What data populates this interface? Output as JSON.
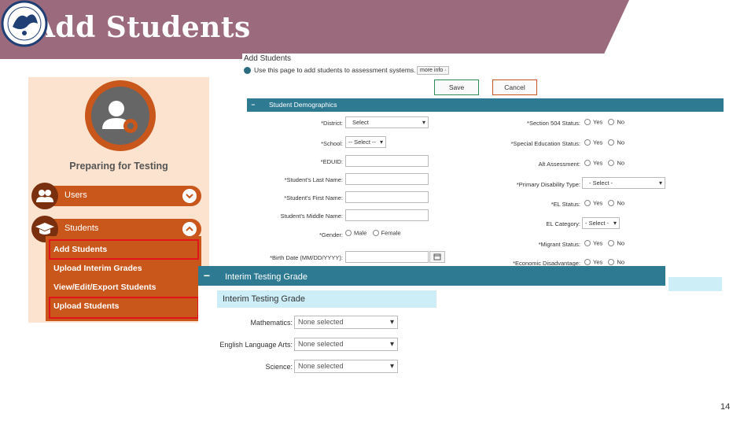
{
  "slide": {
    "title": "Add Students",
    "page_number": "14"
  },
  "colors": {
    "header_band": "#9b6b7d",
    "accent_orange": "#c9561b",
    "panel_peach": "#fbe3cf",
    "section_teal": "#2e7a93",
    "highlight_red": "#e0141b",
    "subhead_light_blue": "#cdeef7"
  },
  "menu": {
    "heading": "Preparing for Testing",
    "items": [
      {
        "label": "Users",
        "icon": "users-icon",
        "chevron": "chevron-down-icon"
      },
      {
        "label": "Students",
        "icon": "graduation-cap-icon",
        "chevron": "chevron-up-icon"
      }
    ],
    "subitems": [
      {
        "label": "Add Students",
        "highlighted": true
      },
      {
        "label": "Upload Interim Grades",
        "highlighted": false
      },
      {
        "label": "View/Edit/Export Students",
        "highlighted": false
      },
      {
        "label": "Upload Students",
        "highlighted": true
      }
    ]
  },
  "form": {
    "title": "Add Students",
    "info": "Use this page to add students to assessment systems.",
    "more_info": "more info ·",
    "save_label": "Save",
    "cancel_label": "Cancel",
    "section_label": "Student Demographics",
    "left_fields": [
      {
        "label": "*District:",
        "value": "Select",
        "type": "select"
      },
      {
        "label": "*School:",
        "value": "-- Select --",
        "type": "select"
      },
      {
        "label": "*EDUID:",
        "value": "",
        "type": "text"
      },
      {
        "label": "*Student's Last Name:",
        "value": "",
        "type": "text"
      },
      {
        "label": "*Student's First Name:",
        "value": "",
        "type": "text"
      },
      {
        "label": "Student's Middle Name:",
        "value": "",
        "type": "text"
      },
      {
        "label": "*Gender:",
        "options": [
          "Male",
          "Female"
        ],
        "type": "radio"
      },
      {
        "label": "*Birth Date (MM/DD/YYYY):",
        "value": "",
        "type": "date"
      }
    ],
    "right_fields": [
      {
        "label": "*Section 504 Status:",
        "options": [
          "Yes",
          "No"
        ],
        "type": "radio"
      },
      {
        "label": "*Special Education Status:",
        "options": [
          "Yes",
          "No"
        ],
        "type": "radio"
      },
      {
        "label": "Alt Assessment:",
        "options": [
          "Yes",
          "No"
        ],
        "type": "radio"
      },
      {
        "label": "*Primary Disability Type:",
        "value": "- Select -",
        "type": "select"
      },
      {
        "label": "*EL Status:",
        "options": [
          "Yes",
          "No"
        ],
        "type": "radio"
      },
      {
        "label": "EL Category:",
        "value": "- Select -",
        "type": "select"
      },
      {
        "label": "*Migrant Status:",
        "options": [
          "Yes",
          "No"
        ],
        "type": "radio"
      },
      {
        "label": "*Economic Disadvantage:",
        "options": [
          "Yes",
          "No"
        ],
        "type": "radio"
      }
    ]
  },
  "interim": {
    "bar_label": "Interim Testing Grade",
    "subheading": "Interim Testing Grade",
    "fields": [
      {
        "label": "Mathematics:",
        "value": "None selected"
      },
      {
        "label": "English Language Arts:",
        "value": "None selected"
      },
      {
        "label": "Science:",
        "value": "None selected"
      }
    ]
  }
}
